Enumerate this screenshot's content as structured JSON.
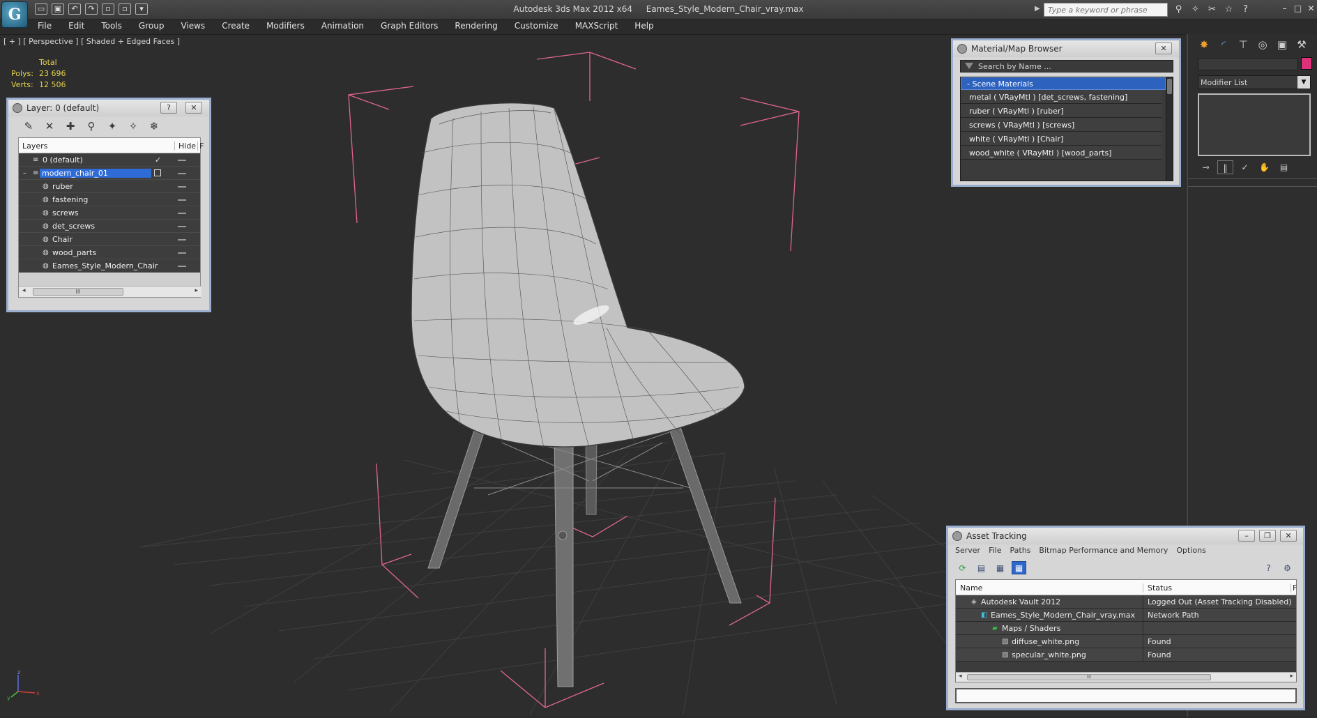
{
  "app": {
    "name": "Autodesk 3ds Max  2012 x64",
    "file": "Eames_Style_Modern_Chair_vray.max",
    "logo": "3ds-max-logo-icon"
  },
  "search": {
    "placeholder": "Type a keyword or phrase"
  },
  "menus": [
    "File",
    "Edit",
    "Tools",
    "Group",
    "Views",
    "Create",
    "Modifiers",
    "Animation",
    "Graph Editors",
    "Rendering",
    "Customize",
    "MAXScript",
    "Help"
  ],
  "viewport": {
    "label": "[ + ] [ Perspective ] [ Shaded + Edged Faces ]",
    "stats": {
      "total_label": "Total",
      "polys_label": "Polys:",
      "polys_value": "23 696",
      "verts_label": "Verts:",
      "verts_value": "12 506"
    },
    "axes": {
      "x": "x",
      "y": "y",
      "z": "z"
    },
    "colors": {
      "background": "#2d2d2d",
      "grid": "#3f3f3f",
      "bbox": "#e0668f"
    }
  },
  "layer_panel": {
    "title": "Layer: 0 (default)",
    "help_label": "?",
    "close_label": "✕",
    "columns": {
      "layers": "Layers",
      "hide": "Hide",
      "freeze": "F"
    },
    "rows": [
      {
        "name": "0 (default)",
        "check": "✓"
      },
      {
        "name": "modern_chair_01"
      },
      {
        "name": "ruber"
      },
      {
        "name": "fastening"
      },
      {
        "name": "screws"
      },
      {
        "name": "det_screws"
      },
      {
        "name": "Chair"
      },
      {
        "name": "wood_parts"
      },
      {
        "name": "Eames_Style_Modern_Chair"
      }
    ],
    "scroll_thumb": "III"
  },
  "material_browser": {
    "title": "Material/Map Browser",
    "close_label": "✕",
    "search_placeholder": "Search by Name ...",
    "group": "- Scene Materials",
    "materials": [
      "metal  ( VRayMtl ) [det_screws, fastening]",
      "ruber  ( VRayMtl ) [ruber]",
      "screws  ( VRayMtl ) [screws]",
      "white  ( VRayMtl ) [Chair]",
      "wood_white  ( VRayMtl ) [wood_parts]"
    ]
  },
  "command_panel": {
    "modifier_list": "Modifier List",
    "object_color": "#e0307a"
  },
  "asset_tracking": {
    "title": "Asset Tracking",
    "menus": [
      "Server",
      "File",
      "Paths",
      "Bitmap Performance and Memory",
      "Options"
    ],
    "columns": {
      "name": "Name",
      "status": "Status",
      "extra": "F"
    },
    "rows": [
      {
        "name": "Autodesk Vault 2012",
        "status": "Logged Out (Asset Tracking Disabled)"
      },
      {
        "name": "Eames_Style_Modern_Chair_vray.max",
        "status": "Network Path"
      },
      {
        "name": "Maps / Shaders",
        "status": ""
      },
      {
        "name": "diffuse_white.png",
        "status": "Found"
      },
      {
        "name": "specular_white.png",
        "status": "Found"
      }
    ],
    "scroll_thumb": "III"
  }
}
